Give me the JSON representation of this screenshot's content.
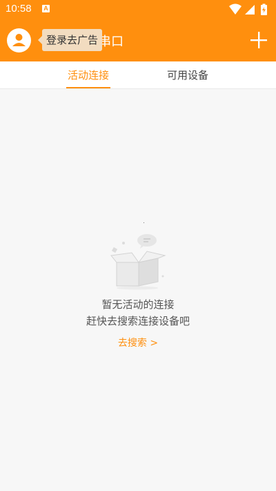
{
  "status_bar": {
    "time": "10:58",
    "notification_badge": "A",
    "icons": [
      "wifi-icon",
      "signal-icon",
      "battery-charging-icon"
    ]
  },
  "header": {
    "title": "串口",
    "login_tooltip": "登录去广告",
    "icons": [
      "avatar-icon",
      "add-icon"
    ]
  },
  "tabs": [
    {
      "label": "活动连接",
      "active": true
    },
    {
      "label": "可用设备",
      "active": false
    }
  ],
  "empty_state": {
    "line1": "暂无活动的连接",
    "line2": "赶快去搜索连接设备吧",
    "action_label": "去搜索 >"
  },
  "colors": {
    "accent": "#ff8f0e",
    "background": "#f7f7f7",
    "tooltip_bg": "#f2dcc0"
  }
}
